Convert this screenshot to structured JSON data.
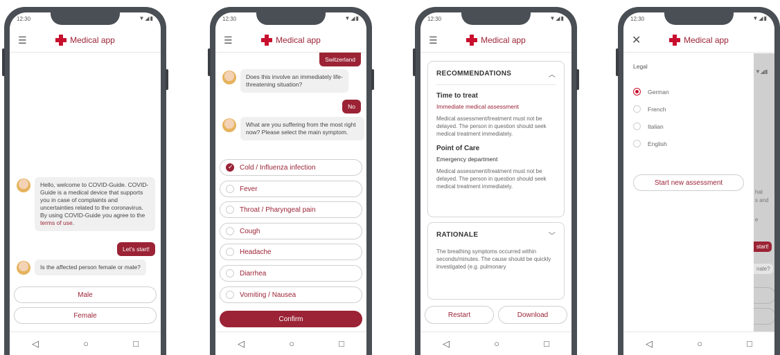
{
  "status": {
    "time": "12:30",
    "icons": "▼◢▮"
  },
  "brand": {
    "name": "Medical app"
  },
  "nav": {
    "back": "◁",
    "home": "○",
    "recent": "□"
  },
  "screen1": {
    "welcome": "Hello, welcome to COVID-Guide. COVID-Guide is a medical device that supports you in case of complaints and uncertainties related to the coronavirus. By using COVID-Guide you agree to the ",
    "terms_link": "terms of use",
    "terms_end": ".",
    "start": "Let's start!",
    "question": "Is the affected person female or male?",
    "options": [
      "Male",
      "Female"
    ]
  },
  "screen2": {
    "prev_answer": "Switzerland",
    "q1": "Does this involve an immediately life-threatening situation?",
    "a1": "No",
    "q2": "What are you suffering from the most right now? Please select the main symptom.",
    "symptoms": [
      "Cold / Influenza infection",
      "Fever",
      "Throat / Pharyngeal pain",
      "Cough",
      "Headache",
      "Diarrhea",
      "Vomiting / Nausea"
    ],
    "confirm": "Confirm"
  },
  "screen3": {
    "rec_title": "RECOMMENDATIONS",
    "time_title": "Time to treat",
    "time_sub": "Immediate medical assessment",
    "time_text": "Medical assessment/treatment must not be delayed. The person in question should seek medical treatment immediately.",
    "poc_title": "Point of Care",
    "poc_sub": "Emergency department",
    "poc_text": "Medical assessment/treatment must not be delayed. The person in question should seek medical treatment immediately.",
    "rat_title": "RATIONALE",
    "rat_text": "The breathing symptoms occurred within seconds/minutes. The cause should be quickly investigated (e.g. pulmonary",
    "restart": "Restart",
    "download": "Download"
  },
  "screen4": {
    "legal": "Legal",
    "languages": [
      "German",
      "French",
      "Italian",
      "English"
    ],
    "new_assessment": "Start new assessment",
    "ghost_lines": [
      "hat",
      "s and",
      "e",
      "start!",
      "nale?"
    ]
  }
}
